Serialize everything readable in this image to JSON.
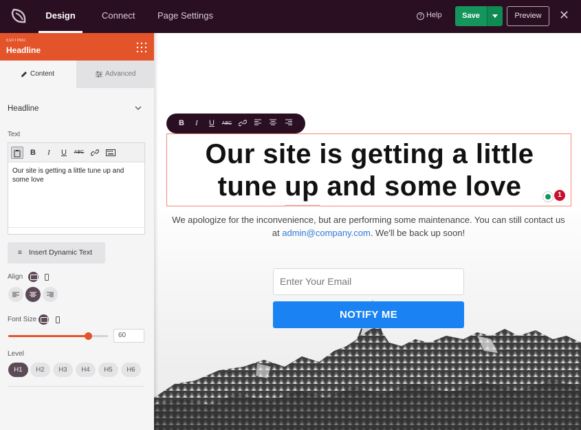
{
  "topbar": {
    "logo_icon": "seedprod-logo-icon",
    "tabs": [
      {
        "label": "Design",
        "active": true
      },
      {
        "label": "Connect",
        "active": false
      },
      {
        "label": "Page Settings",
        "active": false
      }
    ],
    "help_label": "Help",
    "save_label": "Save",
    "preview_label": "Preview",
    "close_icon": "close-icon"
  },
  "panel": {
    "editing_small": "EDITING:",
    "editing_title": "Headline",
    "tabs": [
      {
        "label": "Content",
        "icon": "pencil-icon"
      },
      {
        "label": "Advanced",
        "icon": "sliders-icon"
      }
    ],
    "section_title": "Headline",
    "text_label": "Text",
    "editor_text": "Our site is getting a little tune up and some love",
    "insert_dynamic_label": "Insert Dynamic Text",
    "align_label": "Align",
    "font_size_label": "Font Size",
    "font_size_value": "60",
    "font_size_fraction": 0.8,
    "level_label": "Level",
    "levels": [
      "H1",
      "H2",
      "H3",
      "H4",
      "H5",
      "H6"
    ],
    "selected_level": "H1"
  },
  "canvas": {
    "headline_line1": "Our site is getting a little",
    "headline_line2": "tune up and some love",
    "badge_count": "1",
    "sub_text_1": "We apologize for the inconvenience, but are performing some maintenance. You can still contact us",
    "sub_text_2a": "at ",
    "sub_link": "admin@company.com",
    "sub_text_2b": ". We'll be back up soon!",
    "email_placeholder": "Enter Your Email",
    "notify_label": "NOTIFY ME"
  },
  "colors": {
    "topbar_bg": "#2a0f22",
    "accent": "#e4542a",
    "save_green": "#14955b",
    "notify_blue": "#1a82f2",
    "link_blue": "#2f7bd6"
  }
}
